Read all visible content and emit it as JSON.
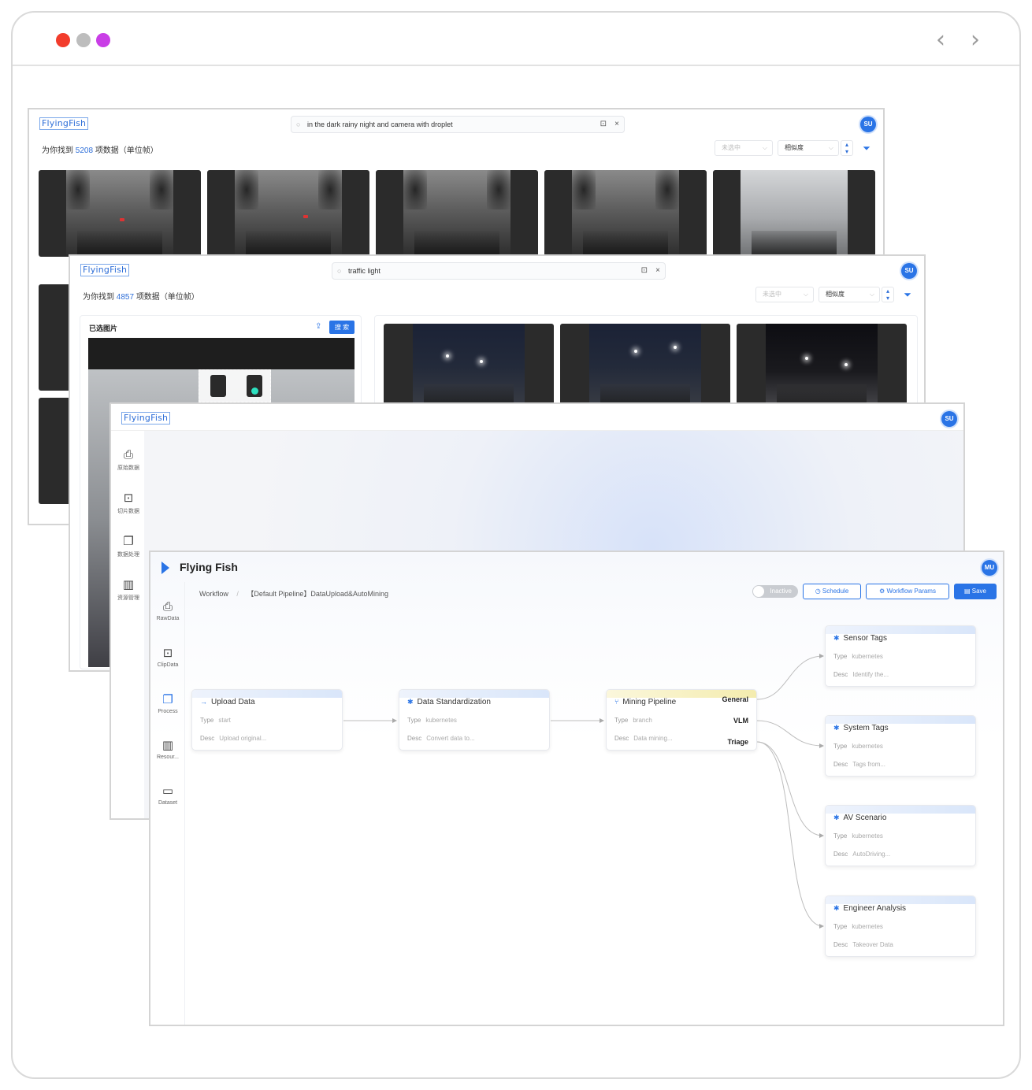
{
  "window1": {
    "logo": "FlyingFish",
    "query": "in the dark rainy night and camera with droplet",
    "result_prefix": "为你找到",
    "result_count": "5208",
    "result_suffix": "项数据（单位帧）",
    "filter_placeholder": "未选中",
    "sort_label": "相似度",
    "avatar": "SU"
  },
  "window2": {
    "logo": "FlyingFish",
    "query": "traffic light",
    "result_prefix": "为你找到",
    "result_count": "4857",
    "result_suffix": "项数据（单位帧）",
    "filter_placeholder": "未选中",
    "sort_label": "相似度",
    "avatar": "SU",
    "selected_image_title": "已选图片",
    "search_button": "搜 索"
  },
  "window3": {
    "logo": "FlyingFish",
    "avatar": "SU",
    "sidebar": [
      {
        "label": "原始数据",
        "icon": "printer-icon"
      },
      {
        "label": "切片数据",
        "icon": "image-search-icon"
      },
      {
        "label": "数据处理",
        "icon": "copy-icon"
      },
      {
        "label": "资源管理",
        "icon": "chart-icon"
      }
    ]
  },
  "window4": {
    "logo": "Flying Fish",
    "avatar": "MU",
    "breadcrumb": [
      "Workflow",
      "【Default Pipeline】DataUpload&AutoMining"
    ],
    "toggle_label": "Inactive",
    "buttons": {
      "schedule": "Schedule",
      "params": "Workflow Params",
      "save": "Save"
    },
    "sidebar": [
      {
        "label": "RawData",
        "icon": "printer-icon"
      },
      {
        "label": "ClipData",
        "icon": "image-search-icon"
      },
      {
        "label": "Process",
        "icon": "copy-icon"
      },
      {
        "label": "Resour...",
        "icon": "chart-icon"
      },
      {
        "label": "Dataset",
        "icon": "folder-icon"
      }
    ],
    "nodes": [
      {
        "title": "Upload Data",
        "type": "start",
        "desc": "Upload original...",
        "type_label": "Type",
        "desc_label": "Desc"
      },
      {
        "title": "Data Standardization",
        "type": "kubernetes",
        "desc": "Convert data to...",
        "type_label": "Type",
        "desc_label": "Desc"
      },
      {
        "title": "Mining Pipeline",
        "type": "branch",
        "desc": "Data mining...",
        "type_label": "Type",
        "desc_label": "Desc"
      },
      {
        "title": "Sensor Tags",
        "type": "kubernetes",
        "desc": "Identify the...",
        "type_label": "Type",
        "desc_label": "Desc"
      },
      {
        "title": "System Tags",
        "type": "kubernetes",
        "desc": "Tags from...",
        "type_label": "Type",
        "desc_label": "Desc"
      },
      {
        "title": "AV Scenario",
        "type": "kubernetes",
        "desc": "AutoDriving...",
        "type_label": "Type",
        "desc_label": "Desc"
      },
      {
        "title": "Engineer Analysis",
        "type": "kubernetes",
        "desc": "Takeover Data",
        "type_label": "Type",
        "desc_label": "Desc"
      }
    ],
    "branch_ports": [
      "General",
      "VLM",
      "Triage"
    ]
  },
  "colors": {
    "accent": "#2a74e6",
    "branch": "#f4ecae"
  }
}
